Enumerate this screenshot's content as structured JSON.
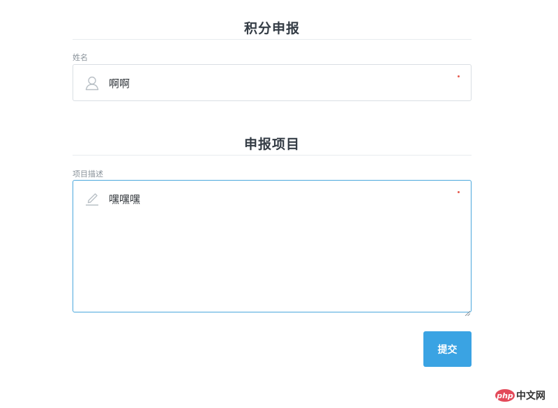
{
  "section1": {
    "title": "积分申报",
    "name_label": "姓名",
    "name_value": "啊啊",
    "name_icon": "user-icon"
  },
  "section2": {
    "title": "申报项目",
    "desc_label": "项目描述",
    "desc_value": "嘿嘿嘿",
    "desc_icon": "pencil-icon"
  },
  "submit_label": "提交",
  "watermark": {
    "badge": "php",
    "text": "中文网"
  },
  "colors": {
    "accent": "#3aa3e3",
    "required": "#e65b4f",
    "focus_border": "#4aa7dc"
  }
}
